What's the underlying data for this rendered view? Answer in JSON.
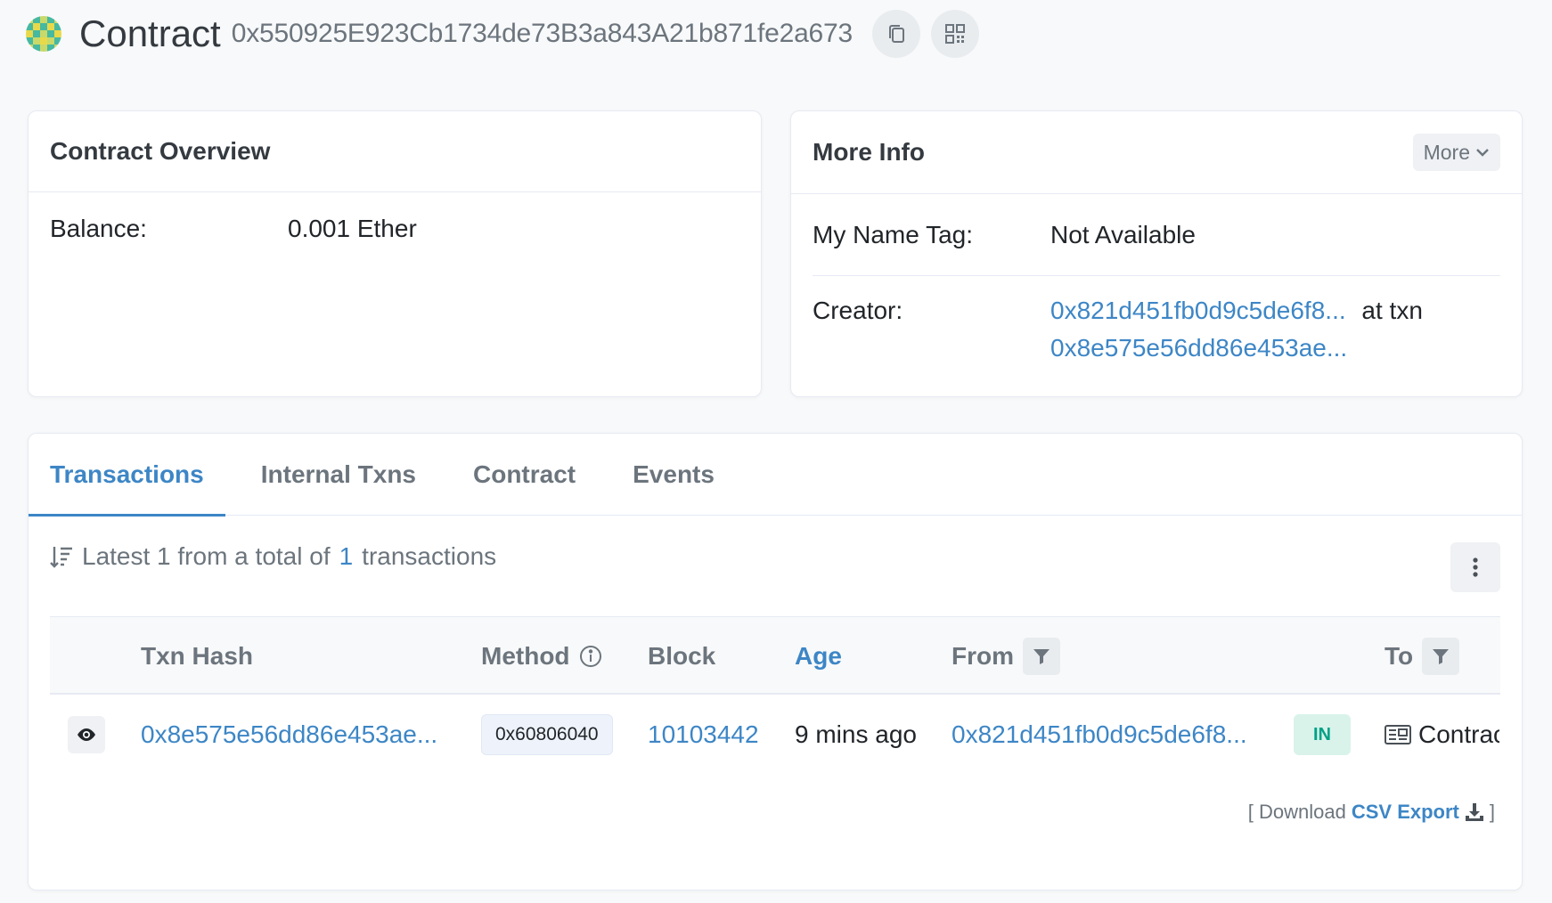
{
  "header": {
    "title": "Contract",
    "address": "0x550925E923Cb1734de73B3a843A21b871fe2a673",
    "copy_icon": "copy-icon",
    "qr_icon": "qr-code-icon"
  },
  "overview": {
    "title": "Contract Overview",
    "balance_label": "Balance:",
    "balance_value": "0.001 Ether"
  },
  "more_info": {
    "title": "More Info",
    "more_label": "More",
    "name_tag_label": "My Name Tag:",
    "name_tag_value": "Not Available",
    "creator_label": "Creator:",
    "creator_address": "0x821d451fb0d9c5de6f8...",
    "at_txn": "at txn",
    "creator_txn": "0x8e575e56dd86e453ae..."
  },
  "tabs": [
    {
      "label": "Transactions",
      "active": true
    },
    {
      "label": "Internal Txns",
      "active": false
    },
    {
      "label": "Contract",
      "active": false
    },
    {
      "label": "Events",
      "active": false
    }
  ],
  "summary": {
    "prefix": "Latest 1 from a total of",
    "count": "1",
    "suffix": "transactions"
  },
  "table": {
    "columns": {
      "txn_hash": "Txn Hash",
      "method": "Method",
      "block": "Block",
      "age": "Age",
      "from": "From",
      "to": "To"
    },
    "rows": [
      {
        "txn_hash": "0x8e575e56dd86e453ae...",
        "method": "0x60806040",
        "block": "10103442",
        "age": "9 mins ago",
        "from": "0x821d451fb0d9c5de6f8...",
        "direction": "IN",
        "to": "Contract Creation"
      }
    ]
  },
  "csv": {
    "open": "[ Download",
    "link": "CSV Export",
    "close": "]"
  },
  "colors": {
    "link": "#3d86c6",
    "in_badge_bg": "#d9f3ea",
    "in_badge_text": "#00a186"
  }
}
